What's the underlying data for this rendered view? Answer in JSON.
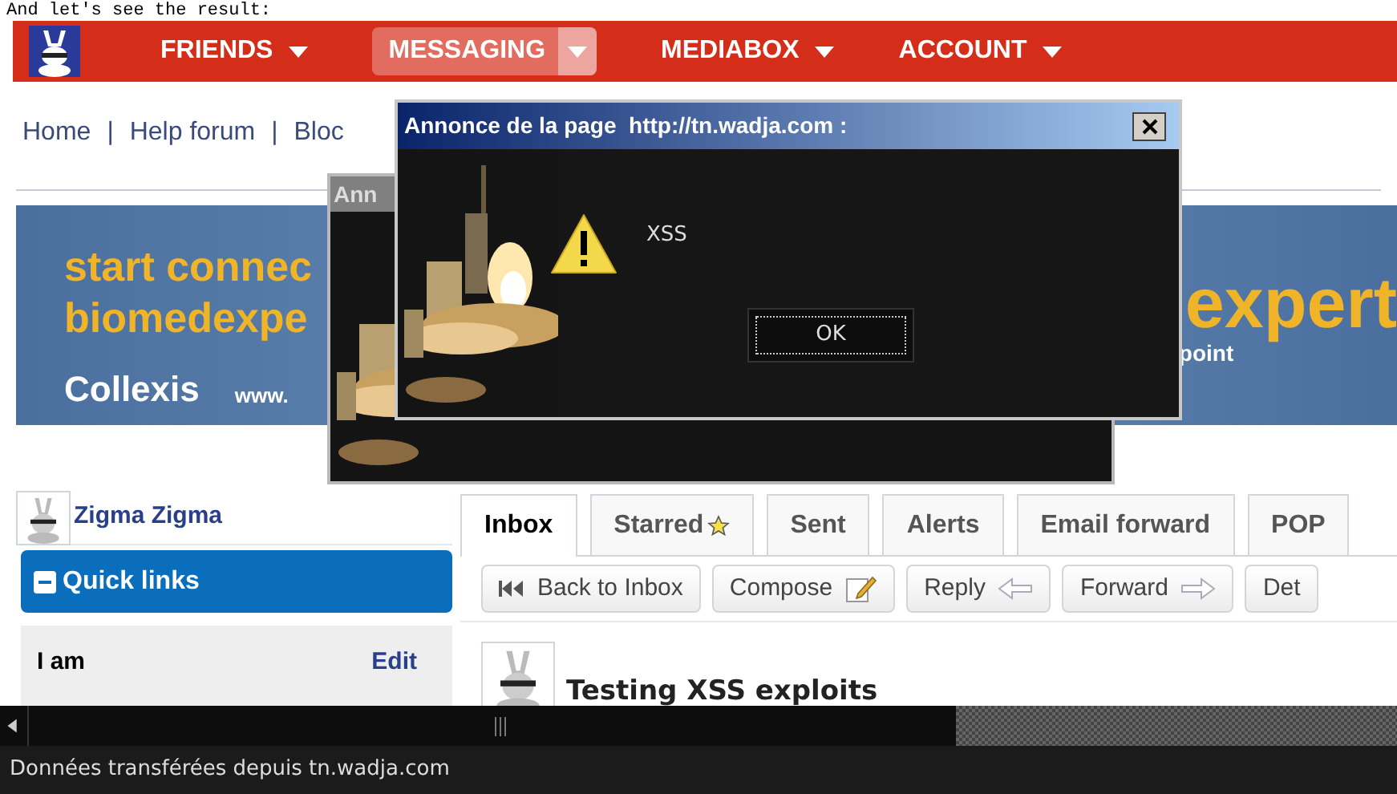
{
  "caption": "And let's see the result:",
  "nav": {
    "items": [
      {
        "label": "FRIENDS",
        "selected": false
      },
      {
        "label": "MESSAGING",
        "selected": true
      },
      {
        "label": "MEDIABOX",
        "selected": false
      },
      {
        "label": "ACCOUNT",
        "selected": false
      }
    ]
  },
  "breadcrumb": {
    "separator": "|",
    "items": [
      "Home",
      "Help forum",
      "Bloc"
    ]
  },
  "banner": {
    "left_lines": [
      "start connec",
      "biomedexpe"
    ],
    "brand": "Collexis",
    "url": "www.",
    "right_lines": [
      "expert",
      "point"
    ]
  },
  "dialogs": [
    {
      "title": "Ann"
    },
    {
      "title": "Annonce de la page  http://tn.wadja.com :",
      "message": "XSS",
      "button": "OK"
    }
  ],
  "profile": {
    "name": "Zigma Zigma"
  },
  "quick_links": {
    "title": "Quick links",
    "expanded": true
  },
  "about": {
    "label": "I am",
    "action": "Edit"
  },
  "tabs": [
    {
      "label": "Inbox",
      "selected": true
    },
    {
      "label": "Starred",
      "selected": false,
      "kind": "star"
    },
    {
      "label": "Sent",
      "selected": false
    },
    {
      "label": "Alerts",
      "selected": false
    },
    {
      "label": "Email forward",
      "selected": false
    },
    {
      "label": "POP",
      "selected": false
    }
  ],
  "toolbar": [
    {
      "label": "Back to Inbox",
      "kind": "first"
    },
    {
      "label": "Compose",
      "kind": "pencil"
    },
    {
      "label": "Reply",
      "kind": "reply"
    },
    {
      "label": "Forward",
      "kind": "forward"
    },
    {
      "label": "Det"
    }
  ],
  "message": {
    "subject": "Testing XSS exploits"
  },
  "status_bar": "Données transférées depuis tn.wadja.com"
}
